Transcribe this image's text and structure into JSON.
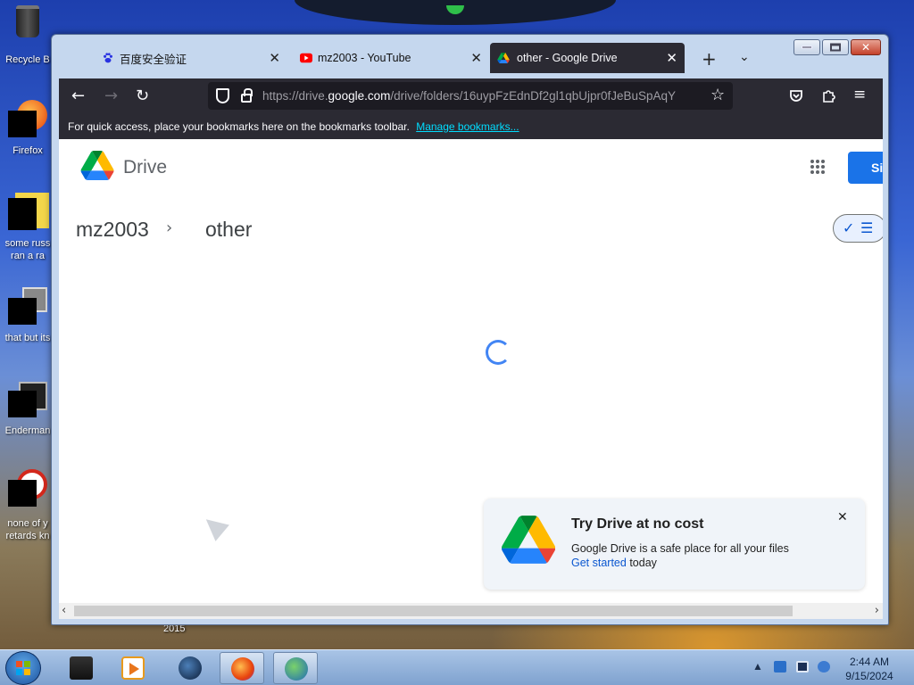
{
  "desktop": {
    "icons": [
      {
        "label": "Recycle B"
      },
      {
        "label": "Firefox"
      },
      {
        "label": "some russ",
        "label2": "ran a ra"
      },
      {
        "label": "that but its"
      },
      {
        "label": "Enderman"
      },
      {
        "label": "none of y",
        "label2": "retards kn"
      }
    ],
    "year_label": "2015"
  },
  "browser": {
    "tabs": [
      {
        "title": "百度安全验证",
        "icon": "baidu-paw-icon",
        "active": false
      },
      {
        "title": "mz2003 - YouTube",
        "icon": "youtube-icon",
        "active": false
      },
      {
        "title": "other - Google Drive",
        "icon": "google-drive-icon",
        "active": true
      }
    ],
    "url": {
      "prefix": "https://drive.",
      "domain": "google.com",
      "path": "/drive/folders/16uypFzEdnDf2gl1qbUjpr0fJeBuSpAqY"
    },
    "bookmarks_bar": {
      "text": "For quick access, place your bookmarks here on the bookmarks toolbar.",
      "link": "Manage bookmarks..."
    }
  },
  "drive": {
    "product": "Drive",
    "signin_label": "Si",
    "breadcrumb": [
      "mz2003",
      "other"
    ],
    "colors": {
      "accent": "#1a73e8",
      "link": "#0b57d0"
    }
  },
  "promo": {
    "title": "Try Drive at no cost",
    "body": "Google Drive is a safe place for all your files",
    "link": "Get started",
    "link_suffix": " today"
  },
  "taskbar": {
    "time": "2:44 AM",
    "date": "9/15/2024"
  }
}
